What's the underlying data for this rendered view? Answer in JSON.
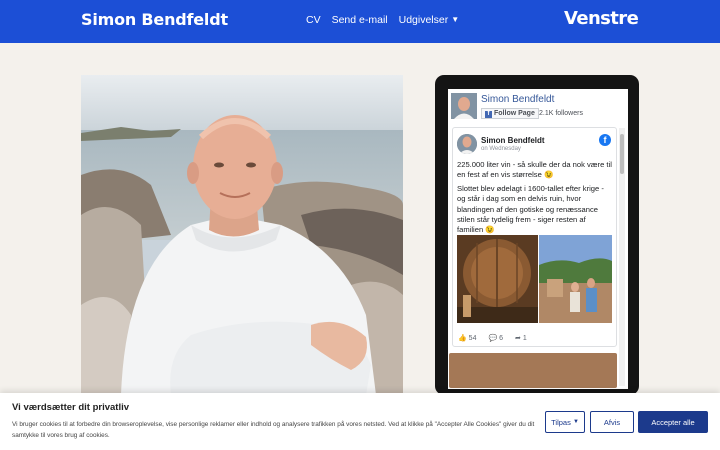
{
  "header": {
    "brand": "Simon Bendfeldt",
    "nav": [
      {
        "label": "CV"
      },
      {
        "label": "Send e-mail"
      },
      {
        "label": "Udgivelser"
      }
    ],
    "logo": "Venstre",
    "colors": {
      "background": "#1c4fd6",
      "text": "#ffffff"
    }
  },
  "facebook_widget": {
    "page_name": "Simon Bendfeldt",
    "follow_label": "Follow Page",
    "followers": "2.1K followers",
    "post": {
      "author": "Simon Bendfeldt",
      "date": "on Wednesday",
      "paragraph1": "225.000 liter vin - så skulle der da nok være til en fest af en vis størrelse 😉",
      "paragraph2": "Slottet blev ødelagt i 1600-tallet efter krige - og står i dag som en delvis ruin, hvor blandingen af den gotiske og renæssance stilen står tydelig frem - siger resten af familien 😉",
      "likes": "54",
      "comments": "6",
      "shares": "1"
    }
  },
  "cookie_banner": {
    "title": "Vi værdsætter dit privatliv",
    "text": "Vi bruger cookies til at forbedre din browseroplevelse, vise personlige reklamer eller indhold og analysere trafikken på vores netsted. Ved at klikke på \"Accepter Alle Cookies\" giver du dit samtykke til vores brug af cookies.",
    "customize": "Tilpas",
    "reject": "Afvis",
    "accept": "Accepter alle",
    "accent": "#1c3a8c"
  }
}
